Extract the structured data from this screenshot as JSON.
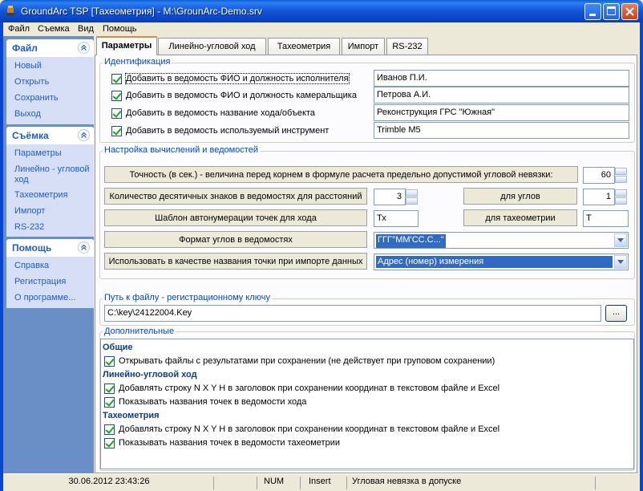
{
  "window": {
    "title": "GroundArc TSP [Тахеометрия] - M:\\GrounArc-Demo.srv"
  },
  "menu": [
    "Файл",
    "Съемка",
    "Вид",
    "Помощь"
  ],
  "nav": {
    "groups": [
      {
        "title": "Файл",
        "items": [
          "Новый",
          "Открыть",
          "Сохранить",
          "Выход"
        ]
      },
      {
        "title": "Съёмка",
        "items": [
          "Параметры",
          "Линейно - угловой ход",
          "Тахеометрия",
          "Импорт",
          "RS-232"
        ]
      },
      {
        "title": "Помощь",
        "items": [
          "Справка",
          "Регистрация",
          "О программе..."
        ]
      }
    ]
  },
  "tabs": [
    "Параметры",
    "Линейно-угловой ход",
    "Тахеометрия",
    "Импорт",
    "RS-232"
  ],
  "ident": {
    "title": "Идентификация",
    "rows": [
      {
        "label": "Добавить в ведомость ФИО и должность исполнителя",
        "value": "Иванов П.И."
      },
      {
        "label": "Добавить в ведомость ФИО и должность камеральщика",
        "value": "Петрова А.И."
      },
      {
        "label": "Добавить в ведомость название хода/объекта",
        "value": "Реконструкция ГРС \"Южная\""
      },
      {
        "label": "Добавить в ведомость используемый инструмент",
        "value": "Trimble M5"
      }
    ]
  },
  "calc": {
    "title": "Настройка вычислений и ведомостей",
    "precision_label": "Точность (в сек.) - величина перед корнем в формуле расчета предельно допустимой угловой невязки:",
    "precision_value": "60",
    "decimals_label": "Количество десятичных знаков в ведомостях для расстояний",
    "decimals_dist": "3",
    "angles_label": "для углов",
    "decimals_angles": "1",
    "template_label": "Шаблон автонумерации точек для хода",
    "template_value": "Тх",
    "tacheo_label": "для тахеометрии",
    "tacheo_value": "Т",
    "format_label": "Формат углов в ведомостях",
    "format_value": "ГГГ°ММ'СС.С...\"",
    "import_label": "Использовать в качестве названия точки при импорте данных",
    "import_value": "Адрес (номер) измерения"
  },
  "keypath": {
    "title": "Путь к файлу - регистрационному ключу",
    "value": "C:\\key\\24122004.Key",
    "browse": "..."
  },
  "extra": {
    "title": "Дополнительные",
    "sections": [
      {
        "title": "Общие",
        "items": [
          "Открывать файлы с результатами при сохранении (не действует при груповом сохранении)"
        ]
      },
      {
        "title": "Линейно-угловой ход",
        "items": [
          "Добавлять строку N X Y H в заголовок при сохранении координат в текстовом файле и Excel",
          "Показывать названия точек в ведомости хода"
        ]
      },
      {
        "title": "Тахеометрия",
        "items": [
          "Добавлять строку N X Y H в заголовок при сохранении координат в текстовом файле и Excel",
          "Показывать названия точек в ведомости тахеометрии"
        ]
      }
    ]
  },
  "status": {
    "datetime": "30.06.2012 23:43:26",
    "num": "NUM",
    "insert": "Insert",
    "message": "Угловая невязка в допуске"
  }
}
